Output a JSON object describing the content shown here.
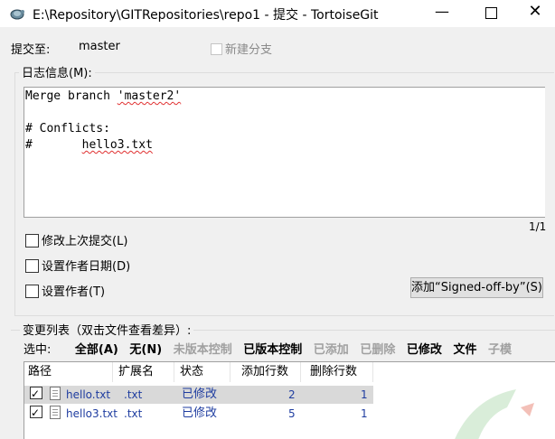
{
  "window": {
    "title": "E:\\Repository\\GITRepositories\\repo1 - 提交 - TortoiseGit",
    "minimize": "—",
    "close": "✕"
  },
  "commit": {
    "to_label": "提交至:",
    "branch": "master",
    "new_branch_label": "新建分支"
  },
  "log": {
    "label": "日志信息(M):",
    "lines": [
      "Merge branch ",
      "'master2'",
      "# Conflicts:",
      "#       ",
      "hello3.txt"
    ],
    "counter": "1/1"
  },
  "options": {
    "amend": "修改上次提交(L)",
    "set_date": "设置作者日期(D)",
    "set_author": "设置作者(T)",
    "signoff_button": "添加“Signed-off-by”(S)"
  },
  "changes": {
    "label": "变更列表（双击文件查看差异）:",
    "select_label": "选中:",
    "filters": [
      {
        "label": "全部(A)",
        "enabled": true
      },
      {
        "label": "无(N)",
        "enabled": true
      },
      {
        "label": "未版本控制",
        "enabled": false
      },
      {
        "label": "已版本控制",
        "enabled": true
      },
      {
        "label": "已添加",
        "enabled": false
      },
      {
        "label": "已删除",
        "enabled": false
      },
      {
        "label": "已修改",
        "enabled": true
      },
      {
        "label": "文件",
        "enabled": true
      },
      {
        "label": "子模",
        "enabled": false
      }
    ],
    "columns": [
      "路径",
      "扩展名",
      "状态",
      "添加行数",
      "删除行数"
    ],
    "rows": [
      {
        "path": "hello.txt",
        "ext": ".txt",
        "status": "已修改",
        "added": "2",
        "deleted": "1",
        "checked": true
      },
      {
        "path": "hello3.txt",
        "ext": ".txt",
        "status": "已修改",
        "added": "5",
        "deleted": "1",
        "checked": true
      }
    ]
  },
  "colors": {
    "link_blue": "#1f3da0",
    "disabled": "#a0a0a0",
    "spell_error": "#e03030"
  }
}
